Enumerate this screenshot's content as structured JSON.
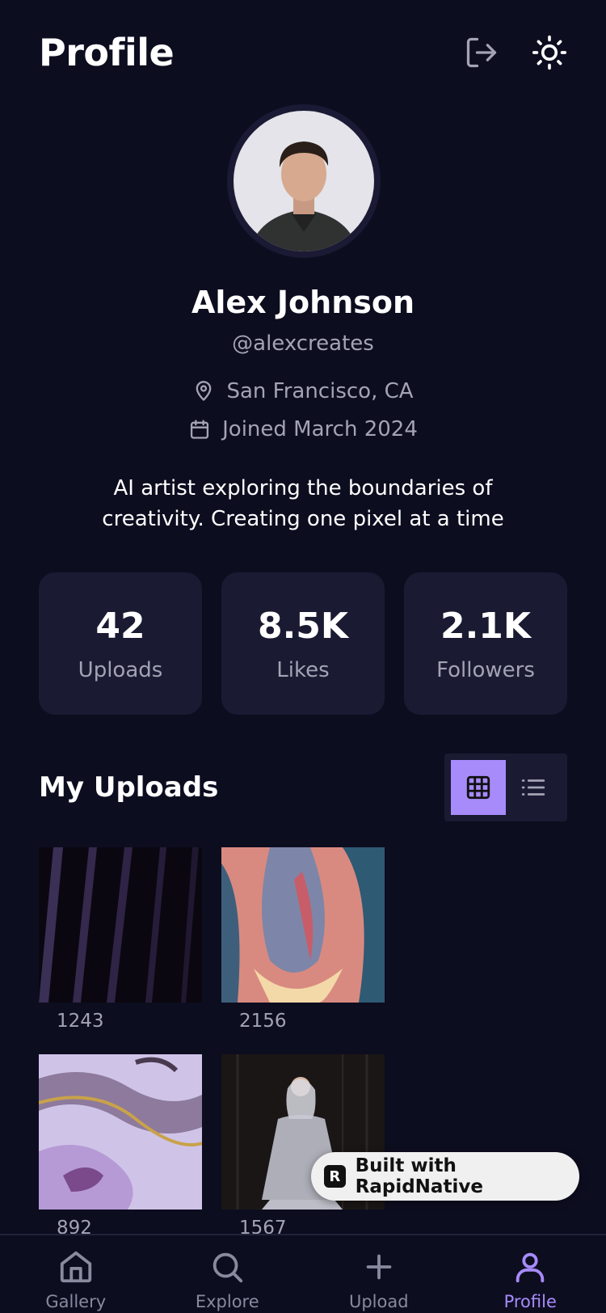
{
  "header": {
    "title": "Profile",
    "logout_icon": "logout-icon",
    "theme_icon": "sun-icon"
  },
  "profile": {
    "name": "Alex Johnson",
    "handle": "@alexcreates",
    "location": "San Francisco, CA",
    "joined": "Joined March 2024",
    "bio": "AI artist exploring the boundaries of creativity. Creating one pixel at a time"
  },
  "stats": [
    {
      "value": "42",
      "label": "Uploads"
    },
    {
      "value": "8.5K",
      "label": "Likes"
    },
    {
      "value": "2.1K",
      "label": "Followers"
    }
  ],
  "uploads": {
    "title": "My Uploads",
    "view_mode": "grid",
    "items": [
      {
        "count": "1243"
      },
      {
        "count": "2156"
      },
      {
        "count": "892"
      },
      {
        "count": "1567"
      }
    ]
  },
  "badge": {
    "label": "Built with RapidNative"
  },
  "tabs": [
    {
      "label": "Gallery",
      "icon": "home-icon"
    },
    {
      "label": "Explore",
      "icon": "search-icon"
    },
    {
      "label": "Upload",
      "icon": "plus-icon"
    },
    {
      "label": "Profile",
      "icon": "user-icon",
      "active": true
    }
  ],
  "colors": {
    "background": "#0d0d20",
    "card": "#1a1a32",
    "accent": "#a78bfa",
    "muted": "#a3a3b5"
  }
}
